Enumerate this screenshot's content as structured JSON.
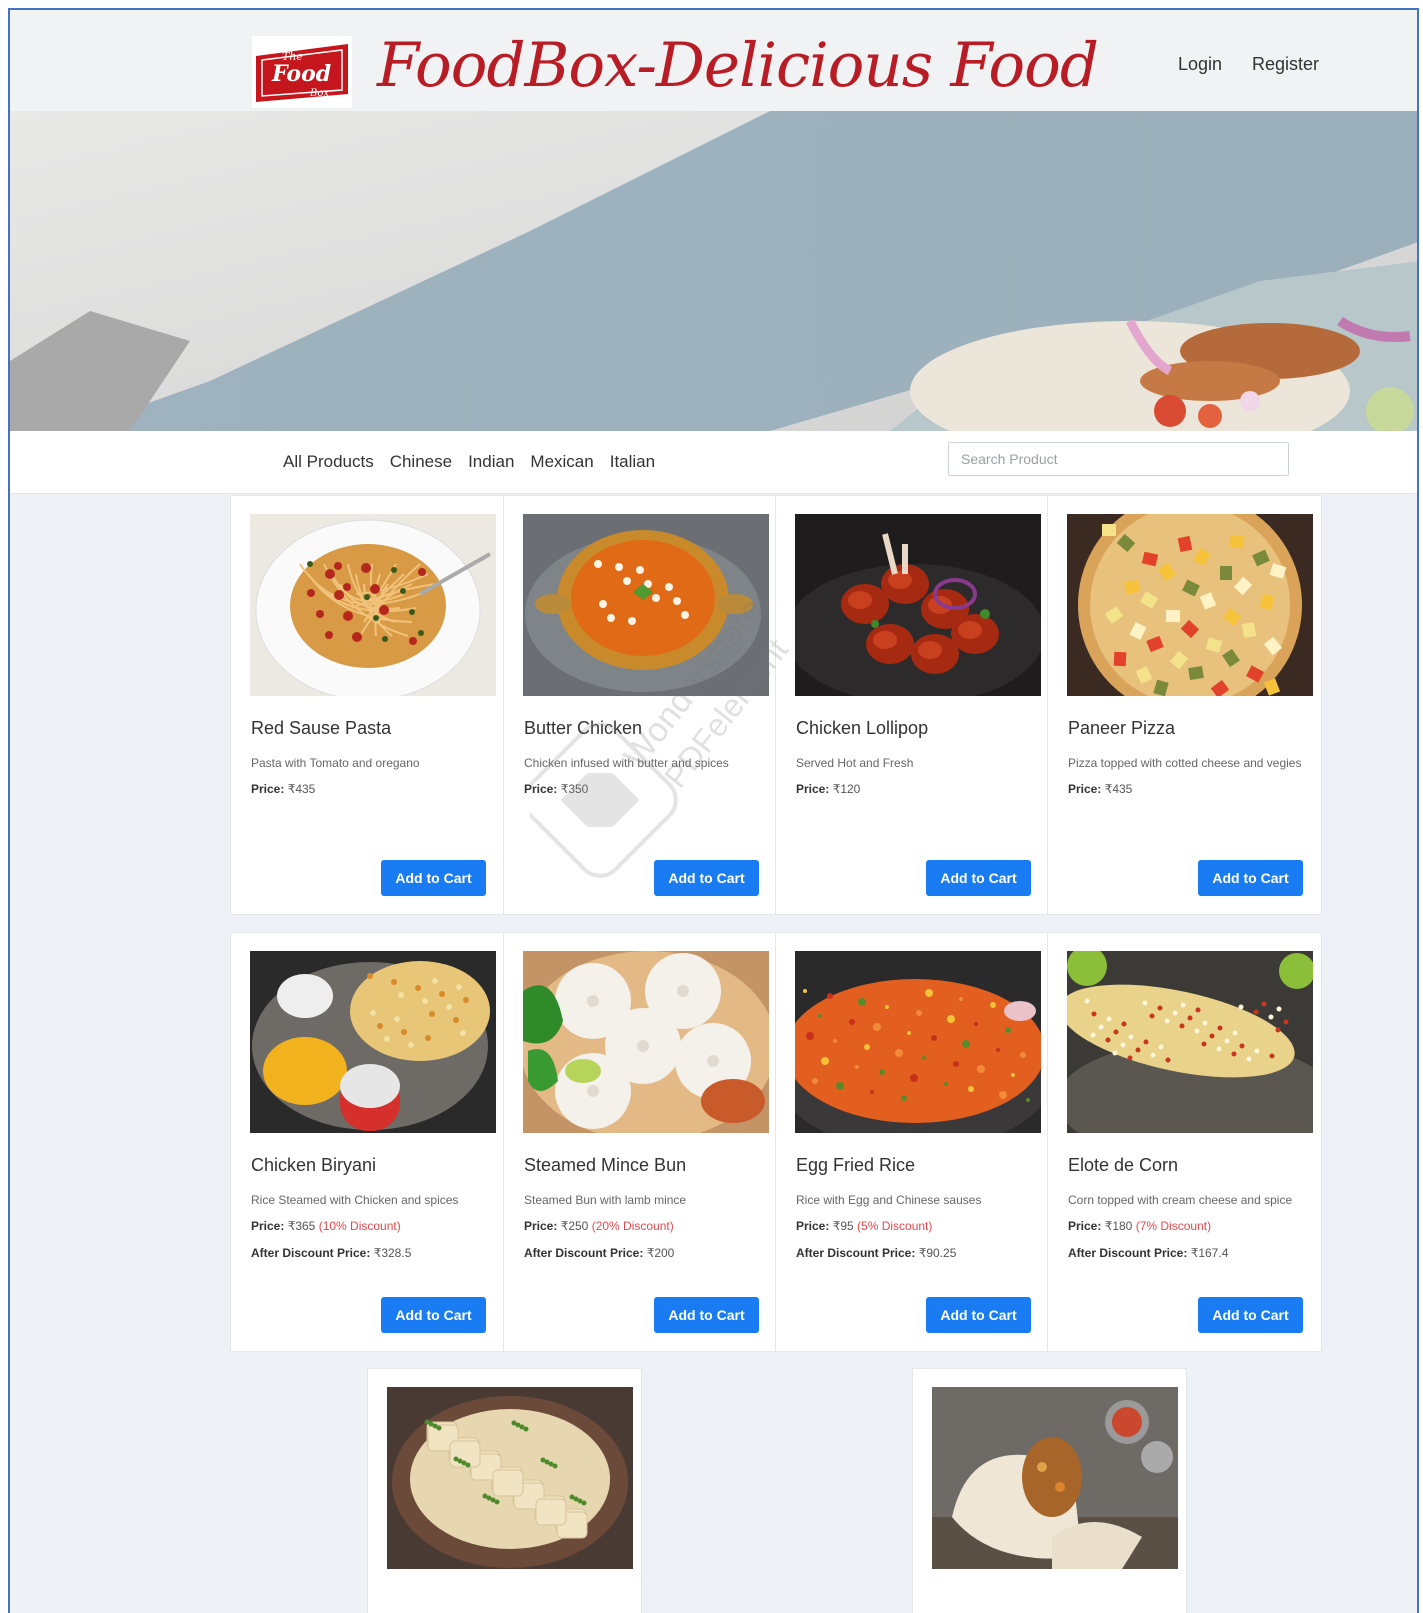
{
  "header": {
    "logo_lines": [
      "The",
      "Food",
      "Box"
    ],
    "brand": "FoodBox-Delicious Food",
    "login": "Login",
    "register": "Register"
  },
  "nav": {
    "categories": [
      "All Products",
      "Chinese",
      "Indian",
      "Mexican",
      "Italian"
    ],
    "search_placeholder": "Search Product"
  },
  "products": [
    {
      "name": "Red Sause Pasta",
      "desc": "Pasta with Tomato and oregano",
      "price_label": "Price:",
      "price": "₹435",
      "discount": "",
      "after_label": "",
      "after": "",
      "button": "Add to Cart",
      "image": "pasta-image"
    },
    {
      "name": "Butter Chicken",
      "desc": "Chicken infused with butter and spices",
      "price_label": "Price:",
      "price": "₹350",
      "discount": "",
      "after_label": "",
      "after": "",
      "button": "Add to Cart",
      "image": "butter-chicken-image"
    },
    {
      "name": "Chicken Lollipop",
      "desc": "Served Hot and Fresh",
      "price_label": "Price:",
      "price": "₹120",
      "discount": "",
      "after_label": "",
      "after": "",
      "button": "Add to Cart",
      "image": "chicken-lollipop-image"
    },
    {
      "name": "Paneer Pizza",
      "desc": "Pizza topped with cotted cheese and vegies",
      "price_label": "Price:",
      "price": "₹435",
      "discount": "",
      "after_label": "",
      "after": "",
      "button": "Add to Cart",
      "image": "paneer-pizza-image"
    },
    {
      "name": "Chicken Biryani",
      "desc": "Rice Steamed with Chicken and spices",
      "price_label": "Price:",
      "price": "₹365",
      "discount": "(10% Discount)",
      "after_label": "After Discount Price:",
      "after": "₹328.5",
      "button": "Add to Cart",
      "image": "chicken-biryani-image"
    },
    {
      "name": "Steamed Mince Bun",
      "desc": "Steamed Bun with lamb mince",
      "price_label": "Price:",
      "price": "₹250",
      "discount": "(20% Discount)",
      "after_label": "After Discount Price:",
      "after": "₹200",
      "button": "Add to Cart",
      "image": "steamed-bun-image"
    },
    {
      "name": "Egg Fried Rice",
      "desc": "Rice with Egg and Chinese sauses",
      "price_label": "Price:",
      "price": "₹95",
      "discount": "(5% Discount)",
      "after_label": "After Discount Price:",
      "after": "₹90.25",
      "button": "Add to Cart",
      "image": "egg-fried-rice-image"
    },
    {
      "name": "Elote de Corn",
      "desc": "Corn topped with cream cheese and spice",
      "price_label": "Price:",
      "price": "₹180",
      "discount": "(7% Discount)",
      "after_label": "After Discount Price:",
      "after": "₹167.4",
      "button": "Add to Cart",
      "image": "elote-corn-image"
    },
    {
      "name": "",
      "desc": "",
      "price_label": "",
      "price": "",
      "discount": "",
      "after_label": "",
      "after": "",
      "button": "",
      "image": "ravioli-image"
    },
    {
      "name": "",
      "desc": "",
      "price_label": "",
      "price": "",
      "discount": "",
      "after_label": "",
      "after": "",
      "button": "",
      "image": "burrito-image"
    }
  ],
  "watermark": {
    "line1": "Wondershare",
    "line2": "PDFelement"
  },
  "colors": {
    "brand": "#b81c24",
    "button": "#1a7cf2",
    "discount": "#e5484d",
    "frame": "#4472c4"
  }
}
